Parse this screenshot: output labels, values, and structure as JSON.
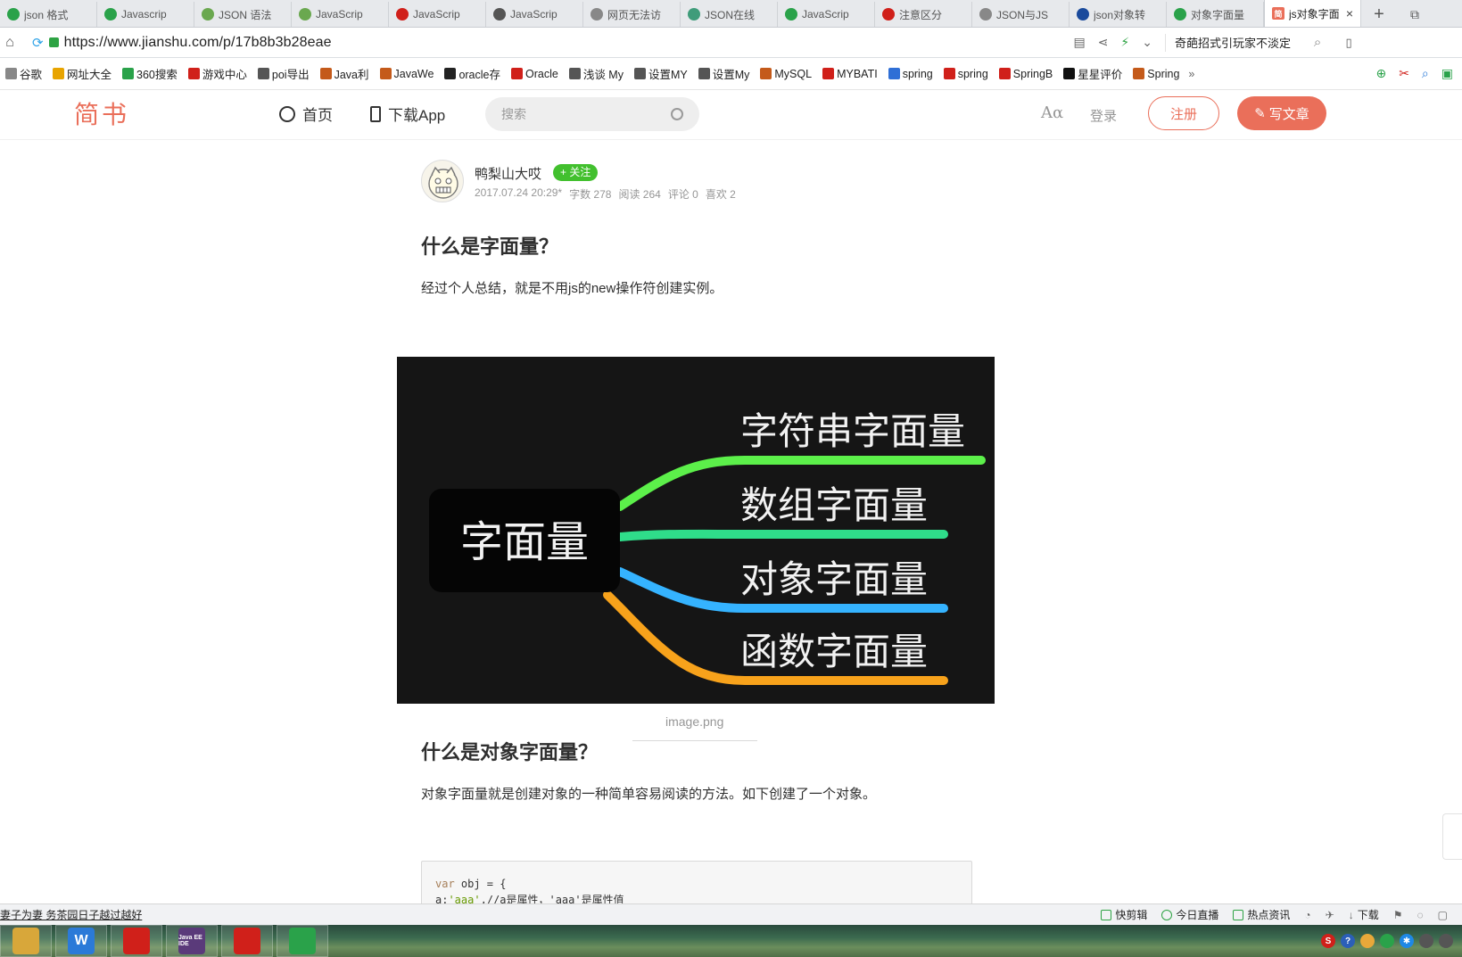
{
  "browser": {
    "tabs": [
      {
        "label": "json 格式",
        "color": "#2aa24a"
      },
      {
        "label": "Javascrip",
        "color": "#2aa24a"
      },
      {
        "label": "JSON 语法",
        "color": "#6aa84f"
      },
      {
        "label": "JavaScrip",
        "color": "#6aa84f"
      },
      {
        "label": "JavaScrip",
        "color": "#d0201a"
      },
      {
        "label": "JavaScrip",
        "color": "#555555"
      },
      {
        "label": "网页无法访",
        "color": "#888888"
      },
      {
        "label": "JSON在线",
        "color": "#3f9c7a"
      },
      {
        "label": "JavaScrip",
        "color": "#2aa24a"
      },
      {
        "label": "注意区分",
        "color": "#d0201a"
      },
      {
        "label": "JSON与JS",
        "color": "#888888"
      },
      {
        "label": "json对象转",
        "color": "#1a4a9c"
      },
      {
        "label": "对象字面量",
        "color": "#2aa24a"
      }
    ],
    "active_tab": {
      "label": "js对象字面",
      "icon": "简",
      "color": "#ea6f5a"
    },
    "url": "https://www.jianshu.com/p/17b8b3b28eae",
    "hot_search": "奇葩招式引玩家不淡定",
    "bookmarks": [
      {
        "label": "谷歌",
        "color": "#888888"
      },
      {
        "label": "网址大全",
        "color": "#e8a400"
      },
      {
        "label": "360搜索",
        "color": "#2aa24a"
      },
      {
        "label": "游戏中心",
        "color": "#d0201a"
      },
      {
        "label": "poi导出",
        "color": "#555555"
      },
      {
        "label": "Java利",
        "color": "#c45a1a"
      },
      {
        "label": "JavaWe",
        "color": "#c45a1a"
      },
      {
        "label": "oracle存",
        "color": "#222222"
      },
      {
        "label": "Oracle",
        "color": "#d0201a"
      },
      {
        "label": "浅谈 My",
        "color": "#555555"
      },
      {
        "label": "设置MY",
        "color": "#555555"
      },
      {
        "label": "设置My",
        "color": "#555555"
      },
      {
        "label": "MySQL",
        "color": "#c45a1a"
      },
      {
        "label": "MYBATI",
        "color": "#d0201a"
      },
      {
        "label": "spring",
        "color": "#2f6fd6"
      },
      {
        "label": "spring",
        "color": "#d0201a"
      },
      {
        "label": "SpringB",
        "color": "#d0201a"
      },
      {
        "label": "星星评价",
        "color": "#111111"
      },
      {
        "label": "Spring",
        "color": "#c45a1a"
      }
    ],
    "bookmark_more": "»",
    "status_text": "妻子为妻 务茶园日子越过越好",
    "status_items": [
      "快剪辑",
      "今日直播",
      "热点资讯",
      "下载"
    ]
  },
  "site": {
    "logo": "简书",
    "nav": {
      "home": "首页",
      "download": "下载App"
    },
    "search_placeholder": "搜索",
    "aa": "Aα",
    "login": "登录",
    "register": "注册",
    "write": "写文章"
  },
  "article": {
    "author": "鸭梨山大哎",
    "follow": "+ 关注",
    "date": "2017.07.24 20:29*",
    "words": "字数 278",
    "reads": "阅读 264",
    "comments": "评论 0",
    "likes": "喜欢 2",
    "heading1": "什么是字面量？",
    "para1": "经过个人总结，就是不用js的new操作符创建实例。",
    "image_caption": "image.png",
    "heading2": "什么是对象字面量？",
    "para2": "对象字面量就是创建对象的一种简单容易阅读的方法。如下创建了一个对象。",
    "code_line1": {
      "kw": "var",
      "rest": " obj = {"
    },
    "code_line2": {
      "key": "a:",
      "str": "'aaa'",
      "rest": ",//a是属性，'aaa'是属性值"
    }
  },
  "mindmap": {
    "center": "字面量",
    "branches": [
      {
        "label": "字符串字面量",
        "color": "#5cf04a"
      },
      {
        "label": "数组字面量",
        "color": "#2fdd8a"
      },
      {
        "label": "对象字面量",
        "color": "#35b3ff"
      },
      {
        "label": "函数字面量",
        "color": "#f7a21b"
      }
    ]
  },
  "taskbar": {
    "apps": [
      {
        "name": "file-explorer",
        "label": "",
        "color": "#d8a73a"
      },
      {
        "name": "wps",
        "label": "W",
        "color": "#2b7ad8"
      },
      {
        "name": "chrome",
        "label": "",
        "color": "#d0201a"
      },
      {
        "name": "java-ee-ide",
        "label": "Java EE IDE",
        "color": "#5a3a7a"
      },
      {
        "name": "app-red",
        "label": "",
        "color": "#d0201a"
      },
      {
        "name": "app-360",
        "label": "",
        "color": "#2aa24a"
      }
    ]
  }
}
